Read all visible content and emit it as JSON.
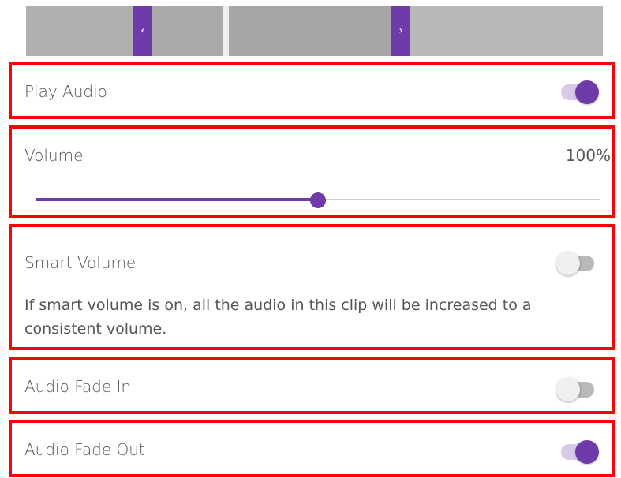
{
  "trim_bar": {
    "left_handle_icon": "chevron-left-icon",
    "right_handle_icon": "chevron-right-icon",
    "left_handle_glyph": "‹",
    "right_handle_glyph": "›"
  },
  "play_audio": {
    "label": "Play Audio",
    "enabled": true
  },
  "volume": {
    "label": "Volume",
    "value_text": "100%",
    "level": 0.5
  },
  "smart_volume": {
    "label": "Smart Volume",
    "enabled": false,
    "description": "If smart volume is on, all the audio in this clip will be increased to a consistent volume."
  },
  "audio_fade_in": {
    "label": "Audio Fade In",
    "enabled": false
  },
  "audio_fade_out": {
    "label": "Audio Fade Out",
    "enabled": true
  },
  "colors": {
    "accent": "#6e3ba8",
    "highlight_border": "#ff0000"
  }
}
